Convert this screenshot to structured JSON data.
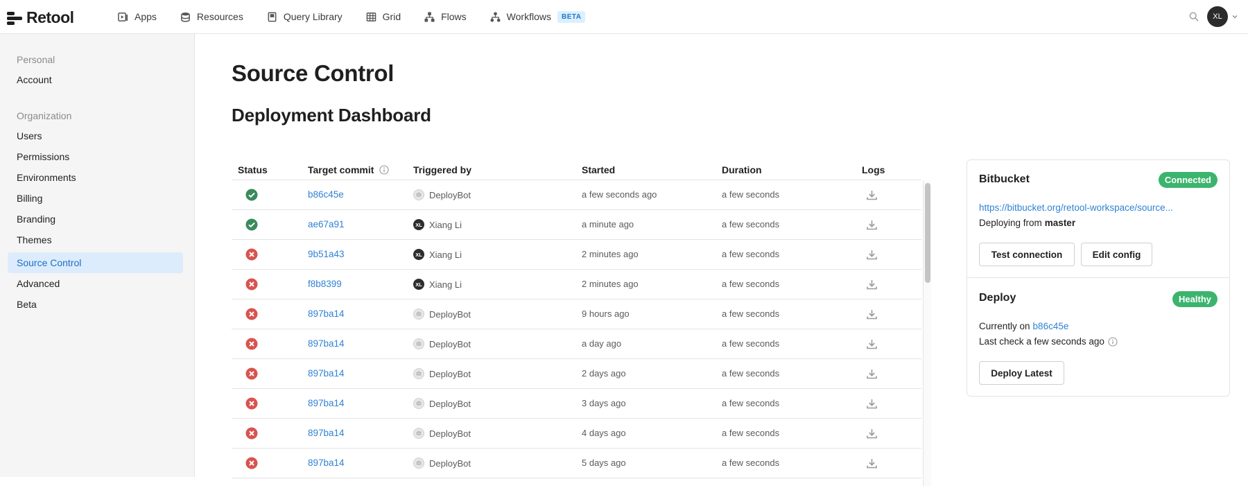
{
  "app": {
    "name": "Retool"
  },
  "nav": {
    "items": [
      {
        "label": "Apps",
        "icon": "apps-icon"
      },
      {
        "label": "Resources",
        "icon": "database-icon"
      },
      {
        "label": "Query Library",
        "icon": "book-icon"
      },
      {
        "label": "Grid",
        "icon": "grid-icon"
      },
      {
        "label": "Flows",
        "icon": "flows-icon"
      },
      {
        "label": "Workflows",
        "icon": "workflows-icon",
        "badge": "BETA"
      }
    ],
    "user_initials": "XL"
  },
  "sidebar": {
    "personal_label": "Personal",
    "personal_items": [
      "Account"
    ],
    "org_label": "Organization",
    "org_items": [
      "Users",
      "Permissions",
      "Environments",
      "Billing",
      "Branding",
      "Themes",
      "Source Control",
      "Advanced",
      "Beta"
    ],
    "active": "Source Control"
  },
  "page": {
    "title": "Source Control",
    "subtitle": "Deployment Dashboard"
  },
  "table": {
    "columns": [
      "Status",
      "Target commit",
      "Triggered by",
      "Started",
      "Duration",
      "Logs"
    ],
    "rows": [
      {
        "status": "success",
        "commit": "b86c45e",
        "by": "DeployBot",
        "by_type": "bot",
        "started": "a few seconds ago",
        "duration": "a few seconds"
      },
      {
        "status": "success",
        "commit": "ae67a91",
        "by": "Xiang Li",
        "by_type": "user",
        "started": "a minute ago",
        "duration": "a few seconds"
      },
      {
        "status": "failed",
        "commit": "9b51a43",
        "by": "Xiang Li",
        "by_type": "user",
        "started": "2 minutes ago",
        "duration": "a few seconds"
      },
      {
        "status": "failed",
        "commit": "f8b8399",
        "by": "Xiang Li",
        "by_type": "user",
        "started": "2 minutes ago",
        "duration": "a few seconds"
      },
      {
        "status": "failed",
        "commit": "897ba14",
        "by": "DeployBot",
        "by_type": "bot",
        "started": "9 hours ago",
        "duration": "a few seconds"
      },
      {
        "status": "failed",
        "commit": "897ba14",
        "by": "DeployBot",
        "by_type": "bot",
        "started": "a day ago",
        "duration": "a few seconds"
      },
      {
        "status": "failed",
        "commit": "897ba14",
        "by": "DeployBot",
        "by_type": "bot",
        "started": "2 days ago",
        "duration": "a few seconds"
      },
      {
        "status": "failed",
        "commit": "897ba14",
        "by": "DeployBot",
        "by_type": "bot",
        "started": "3 days ago",
        "duration": "a few seconds"
      },
      {
        "status": "failed",
        "commit": "897ba14",
        "by": "DeployBot",
        "by_type": "bot",
        "started": "4 days ago",
        "duration": "a few seconds"
      },
      {
        "status": "failed",
        "commit": "897ba14",
        "by": "DeployBot",
        "by_type": "bot",
        "started": "5 days ago",
        "duration": "a few seconds"
      }
    ],
    "user_initials": "XL"
  },
  "bitbucket": {
    "title": "Bitbucket",
    "status": "Connected",
    "url": "https://bitbucket.org/retool-workspace/source...",
    "deploying_prefix": "Deploying from",
    "branch": "master",
    "test_button": "Test connection",
    "edit_button": "Edit config"
  },
  "deploy": {
    "title": "Deploy",
    "status": "Healthy",
    "current_prefix": "Currently on",
    "current_commit": "b86c45e",
    "last_check": "Last check a few seconds ago",
    "deploy_button": "Deploy Latest"
  },
  "colors": {
    "accent": "#2f82d4",
    "success": "#3a8a5c",
    "danger": "#d9534f",
    "pill_green": "#3cb46e",
    "active_bg": "#dcecfd"
  }
}
